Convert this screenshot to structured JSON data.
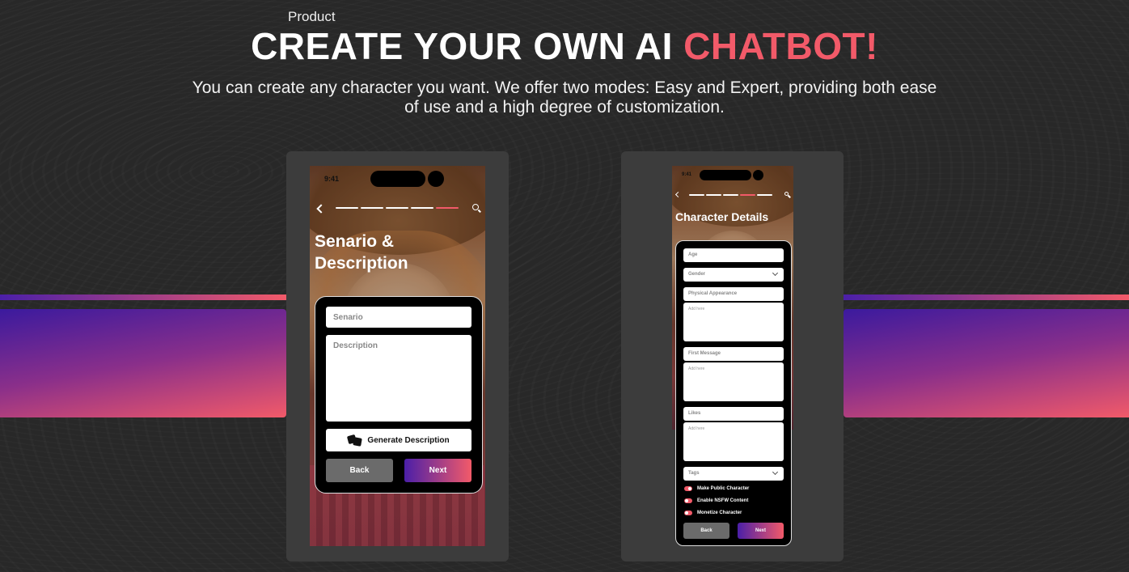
{
  "header": {
    "eyebrow": "Product",
    "headline_main": "CREATE YOUR OWN AI ",
    "headline_accent": "CHATBOT!",
    "subtitle": "You can create any character you want. We offer two modes: Easy and Expert, providing both ease of use and a high degree of customization."
  },
  "colors": {
    "accent": "#f25a69",
    "gradient_start": "#4b1fa8",
    "gradient_end": "#f25a69",
    "background": "#282828"
  },
  "phone1": {
    "status_time": "9:41",
    "progress_steps": 5,
    "active_step": 5,
    "title": "Senario & Description",
    "scenario_placeholder": "Senario",
    "description_placeholder": "Description",
    "generate_label": "Generate Description",
    "back_label": "Back",
    "next_label": "Next"
  },
  "phone2": {
    "status_time": "9:41",
    "progress_steps": 5,
    "active_step": 4,
    "title": "Character Details",
    "fields": {
      "age": "Age",
      "gender": "Gender",
      "physical_appearance": "Physical Appearance",
      "physical_appearance_hint": "Add here",
      "first_message": "First Message",
      "first_message_hint": "Add here",
      "likes": "Likes",
      "likes_hint": "Add here",
      "tags": "Tags"
    },
    "toggles": [
      {
        "label": "Make Public Character",
        "on": true
      },
      {
        "label": "Enable NSFW Content",
        "on": false
      },
      {
        "label": "Monetize Character",
        "on": false
      }
    ],
    "back_label": "Back",
    "next_label": "Next"
  }
}
